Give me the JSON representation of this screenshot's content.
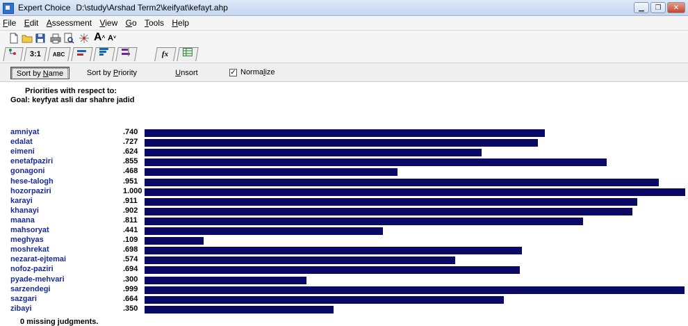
{
  "window": {
    "app_name": "Expert Choice",
    "file_path": "D:\\study\\Arshad Term2\\keifyat\\kefayt.ahp",
    "min_glyph": "▁",
    "max_glyph": "❐",
    "close_glyph": "✕"
  },
  "menu": [
    {
      "pre": "",
      "u": "F",
      "post": "ile"
    },
    {
      "pre": "",
      "u": "E",
      "post": "dit"
    },
    {
      "pre": "",
      "u": "A",
      "post": "ssessment"
    },
    {
      "pre": "",
      "u": "V",
      "post": "iew"
    },
    {
      "pre": "",
      "u": "G",
      "post": "o"
    },
    {
      "pre": "",
      "u": "T",
      "post": "ools"
    },
    {
      "pre": "",
      "u": "H",
      "post": "elp"
    }
  ],
  "toolbar": {
    "font_large": "A",
    "font_small": "A"
  },
  "tabs": {
    "pairwise": "3:1",
    "verbal": "ABC",
    "formula": "fx"
  },
  "actions": {
    "sort_name_pre": "Sort by ",
    "sort_name_u": "N",
    "sort_name_post": "ame",
    "sort_priority_pre": "Sort by ",
    "sort_priority_u": "P",
    "sort_priority_post": "riority",
    "unsort_u": "U",
    "unsort_post": "nsort",
    "normalize_label_pre": "Norma",
    "normalize_label_u": "l",
    "normalize_label_post": "ize",
    "normalize_checked": true,
    "check_glyph": "✓"
  },
  "report": {
    "heading": "Priorities with respect to:",
    "goal": "Goal: keyfyat asli dar shahre jadid",
    "missing": "0 missing judgments.",
    "bar_color": "#0a0a66",
    "items": [
      {
        "name": "amniyat",
        "value": ".740",
        "level": 0.74
      },
      {
        "name": "edalat",
        "value": ".727",
        "level": 0.727
      },
      {
        "name": "eimeni",
        "value": ".624",
        "level": 0.624
      },
      {
        "name": "enetafpaziri",
        "value": ".855",
        "level": 0.855
      },
      {
        "name": "gonagoni",
        "value": ".468",
        "level": 0.468
      },
      {
        "name": "hese-talogh",
        "value": ".951",
        "level": 0.951
      },
      {
        "name": "hozorpaziri",
        "value": "1.000",
        "level": 1.0
      },
      {
        "name": "karayi",
        "value": ".911",
        "level": 0.911
      },
      {
        "name": "khanayi",
        "value": ".902",
        "level": 0.902
      },
      {
        "name": "maana",
        "value": ".811",
        "level": 0.811
      },
      {
        "name": "mahsoryat",
        "value": ".441",
        "level": 0.441
      },
      {
        "name": "meghyas",
        "value": ".109",
        "level": 0.109
      },
      {
        "name": "moshrekat",
        "value": ".698",
        "level": 0.698
      },
      {
        "name": "nezarat-ejtemai",
        "value": ".574",
        "level": 0.574
      },
      {
        "name": "nofoz-paziri",
        "value": ".694",
        "level": 0.694
      },
      {
        "name": "pyade-mehvari",
        "value": ".300",
        "level": 0.3
      },
      {
        "name": "sarzendegi",
        "value": ".999",
        "level": 0.999
      },
      {
        "name": "sazgari",
        "value": ".664",
        "level": 0.664
      },
      {
        "name": "zibayi",
        "value": ".350",
        "level": 0.35
      }
    ]
  }
}
